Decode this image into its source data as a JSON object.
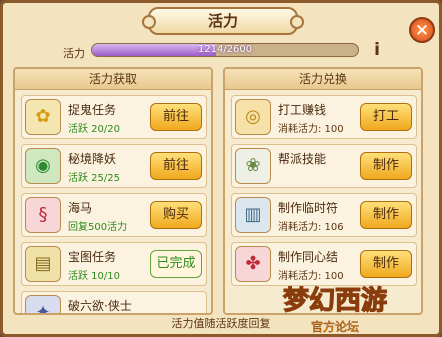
{
  "title": "活力",
  "close_label": "✕",
  "vitality": {
    "label": "活力",
    "text": "1214/2600",
    "current": 1214,
    "max": 2600
  },
  "info_label": "i",
  "left_column": {
    "header": "活力获取",
    "rows": [
      {
        "icon": "flower-icon",
        "glyph": "✿",
        "name": "捉鬼任务",
        "sub": "活跃 20/20",
        "button": "前往"
      },
      {
        "icon": "green-orb-icon",
        "glyph": "◉",
        "name": "秘境降妖",
        "sub": "活跃 25/25",
        "button": "前往"
      },
      {
        "icon": "seahorse-icon",
        "glyph": "§",
        "name": "海马",
        "sub": "回复500活力",
        "button": "购买"
      },
      {
        "icon": "treasure-map-icon",
        "glyph": "▤",
        "name": "宝图任务",
        "sub": "活跃 10/10",
        "button": "已完成"
      },
      {
        "icon": "quest-icon",
        "glyph": "✦",
        "name": "破六欲·侠士",
        "sub": "",
        "button": ""
      }
    ]
  },
  "right_column": {
    "header": "活力兑换",
    "rows": [
      {
        "icon": "coin-bag-icon",
        "glyph": "◎",
        "name": "打工赚钱",
        "sub": "消耗活力: 100",
        "button": "打工"
      },
      {
        "icon": "cauliflower-icon",
        "glyph": "❀",
        "name": "帮派技能",
        "sub": "",
        "button": "制作"
      },
      {
        "icon": "talisman-icon",
        "glyph": "▥",
        "name": "制作临时符",
        "sub": "消耗活力: 106",
        "button": "制作"
      },
      {
        "icon": "knot-icon",
        "glyph": "✤",
        "name": "制作同心结",
        "sub": "消耗活力: 100",
        "button": "制作"
      }
    ]
  },
  "footer_text": "活力值随活跃度回复",
  "watermark": "梦幻西游 官方论坛",
  "colors": {
    "accent": "#f0a81e",
    "progress": "#9c5cc8",
    "active_green": "#2f8b1f"
  }
}
